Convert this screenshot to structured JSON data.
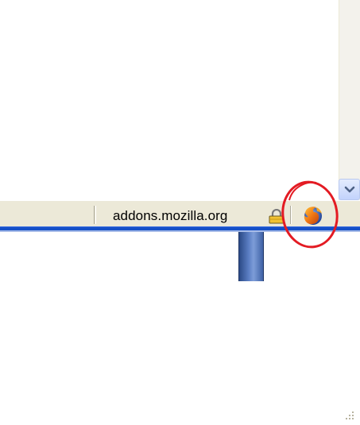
{
  "statusbar": {
    "url_text": "addons.mozilla.org"
  },
  "icons": {
    "scroll_down": "chevron-down-icon",
    "security": "padlock-icon",
    "browser": "firefox-icon",
    "resize": "resize-grip-icon"
  },
  "colors": {
    "annotation_ring": "#e31b23",
    "taskbar_blue": "#1550c8",
    "statusbar_bg": "#ece9d8",
    "scroll_button": "#c2d3fc"
  }
}
